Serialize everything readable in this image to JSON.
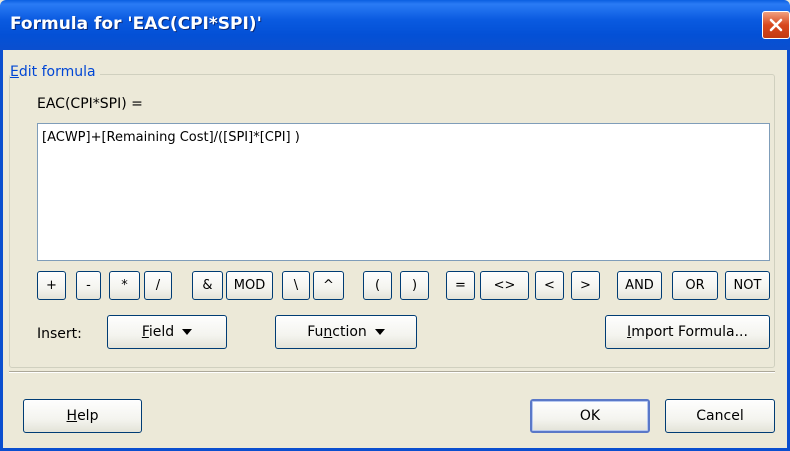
{
  "window": {
    "title": "Formula for 'EAC(CPI*SPI)'"
  },
  "edit_group": {
    "legend_first": "E",
    "legend_rest": "dit formula"
  },
  "formula": {
    "label": "EAC(CPI*SPI) =",
    "value": "[ACWP]+[Remaining Cost]/([SPI]*[CPI] )"
  },
  "operators": [
    "+",
    "-",
    "*",
    "/",
    "&",
    "MOD",
    "\\",
    "^",
    "(",
    ")",
    "=",
    "<>",
    "<",
    ">",
    "AND",
    "OR",
    "NOT"
  ],
  "insert": {
    "label": "Insert:",
    "field": {
      "pre": "",
      "acc": "F",
      "post": "ield"
    },
    "function": {
      "pre": "Fu",
      "acc": "n",
      "post": "ction"
    },
    "import": {
      "pre": "",
      "acc": "I",
      "post": "mport Formula..."
    }
  },
  "footer": {
    "help": {
      "pre": "",
      "acc": "H",
      "post": "elp"
    },
    "ok": "OK",
    "cancel": "Cancel"
  },
  "icons": {
    "close": "close-icon",
    "dropdown": "chevron-down-icon"
  },
  "colors": {
    "title_bar": "#0a5ae0",
    "dialog_bg": "#ece9d8",
    "legend_text": "#0046d5",
    "close_button": "#d8491e"
  }
}
